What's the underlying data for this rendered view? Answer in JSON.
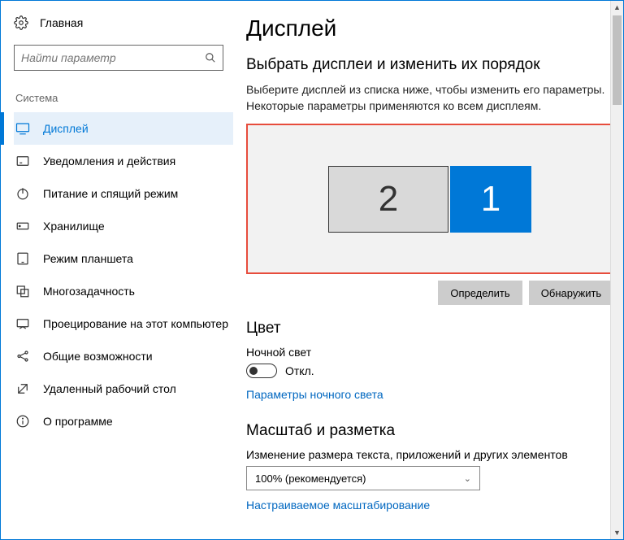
{
  "sidebar": {
    "home": "Главная",
    "search_placeholder": "Найти параметр",
    "section": "Система",
    "items": [
      {
        "label": "Дисплей",
        "icon": "monitor",
        "active": true
      },
      {
        "label": "Уведомления и действия",
        "icon": "notification"
      },
      {
        "label": "Питание и спящий режим",
        "icon": "power"
      },
      {
        "label": "Хранилище",
        "icon": "storage"
      },
      {
        "label": "Режим планшета",
        "icon": "tablet"
      },
      {
        "label": "Многозадачность",
        "icon": "multitask"
      },
      {
        "label": "Проецирование на этот компьютер",
        "icon": "project"
      },
      {
        "label": "Общие возможности",
        "icon": "shared"
      },
      {
        "label": "Удаленный рабочий стол",
        "icon": "remote"
      },
      {
        "label": "О программе",
        "icon": "about"
      }
    ]
  },
  "main": {
    "title": "Дисплей",
    "arrange_heading": "Выбрать дисплеи и изменить их порядок",
    "arrange_text": "Выберите дисплей из списка ниже, чтобы изменить его параметры. Некоторые параметры применяются ко всем дисплеям.",
    "monitors": {
      "left": "2",
      "right": "1"
    },
    "buttons": {
      "identify": "Определить",
      "detect": "Обнаружить"
    },
    "color_heading": "Цвет",
    "night_light_label": "Ночной свет",
    "night_light_state": "Откл.",
    "night_light_link": "Параметры ночного света",
    "scale_heading": "Масштаб и разметка",
    "scale_label": "Изменение размера текста, приложений и других элементов",
    "scale_value": "100% (рекомендуется)",
    "scale_custom_link": "Настраиваемое масштабирование"
  }
}
